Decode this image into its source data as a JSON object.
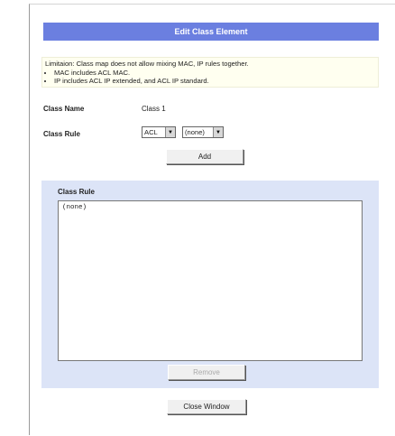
{
  "header": {
    "title": "Edit Class Element"
  },
  "info": {
    "limitation": "Limitaion: Class map does not allow mixing MAC, IP rules together.",
    "bullets": [
      "MAC includes ACL MAC.",
      "IP includes ACL IP extended, and ACL IP standard."
    ]
  },
  "class_name": {
    "label": "Class Name",
    "value": "Class 1"
  },
  "class_rule": {
    "label": "Class Rule",
    "type_select": {
      "value": "ACL"
    },
    "acl_select": {
      "value": "(none)"
    }
  },
  "buttons": {
    "add": "Add",
    "remove": "Remove",
    "close": "Close Window"
  },
  "rule_panel": {
    "title": "Class Rule",
    "items": [
      "(none)"
    ]
  }
}
